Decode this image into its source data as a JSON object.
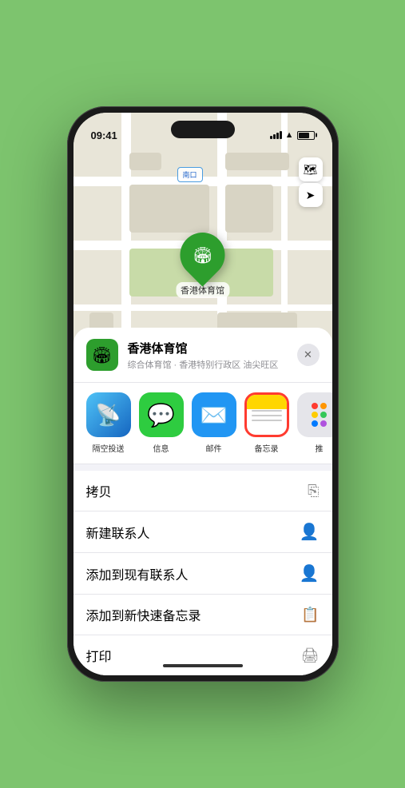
{
  "status": {
    "time": "09:41",
    "location_arrow": "▲"
  },
  "map": {
    "label": "南口",
    "controls": [
      "🗺",
      "➤"
    ]
  },
  "location_card": {
    "name": "香港体育馆",
    "subtitle": "综合体育馆 · 香港特别行政区 油尖旺区",
    "close": "✕"
  },
  "share_items": [
    {
      "label": "隔空投送",
      "type": "airdrop"
    },
    {
      "label": "信息",
      "type": "messages"
    },
    {
      "label": "邮件",
      "type": "mail"
    },
    {
      "label": "备忘录",
      "type": "notes"
    },
    {
      "label": "推",
      "type": "more"
    }
  ],
  "actions": [
    {
      "label": "拷贝",
      "icon": "⎘"
    },
    {
      "label": "新建联系人",
      "icon": "👤"
    },
    {
      "label": "添加到现有联系人",
      "icon": "👤"
    },
    {
      "label": "添加到新快速备忘录",
      "icon": "📋"
    },
    {
      "label": "打印",
      "icon": "🖨"
    }
  ]
}
